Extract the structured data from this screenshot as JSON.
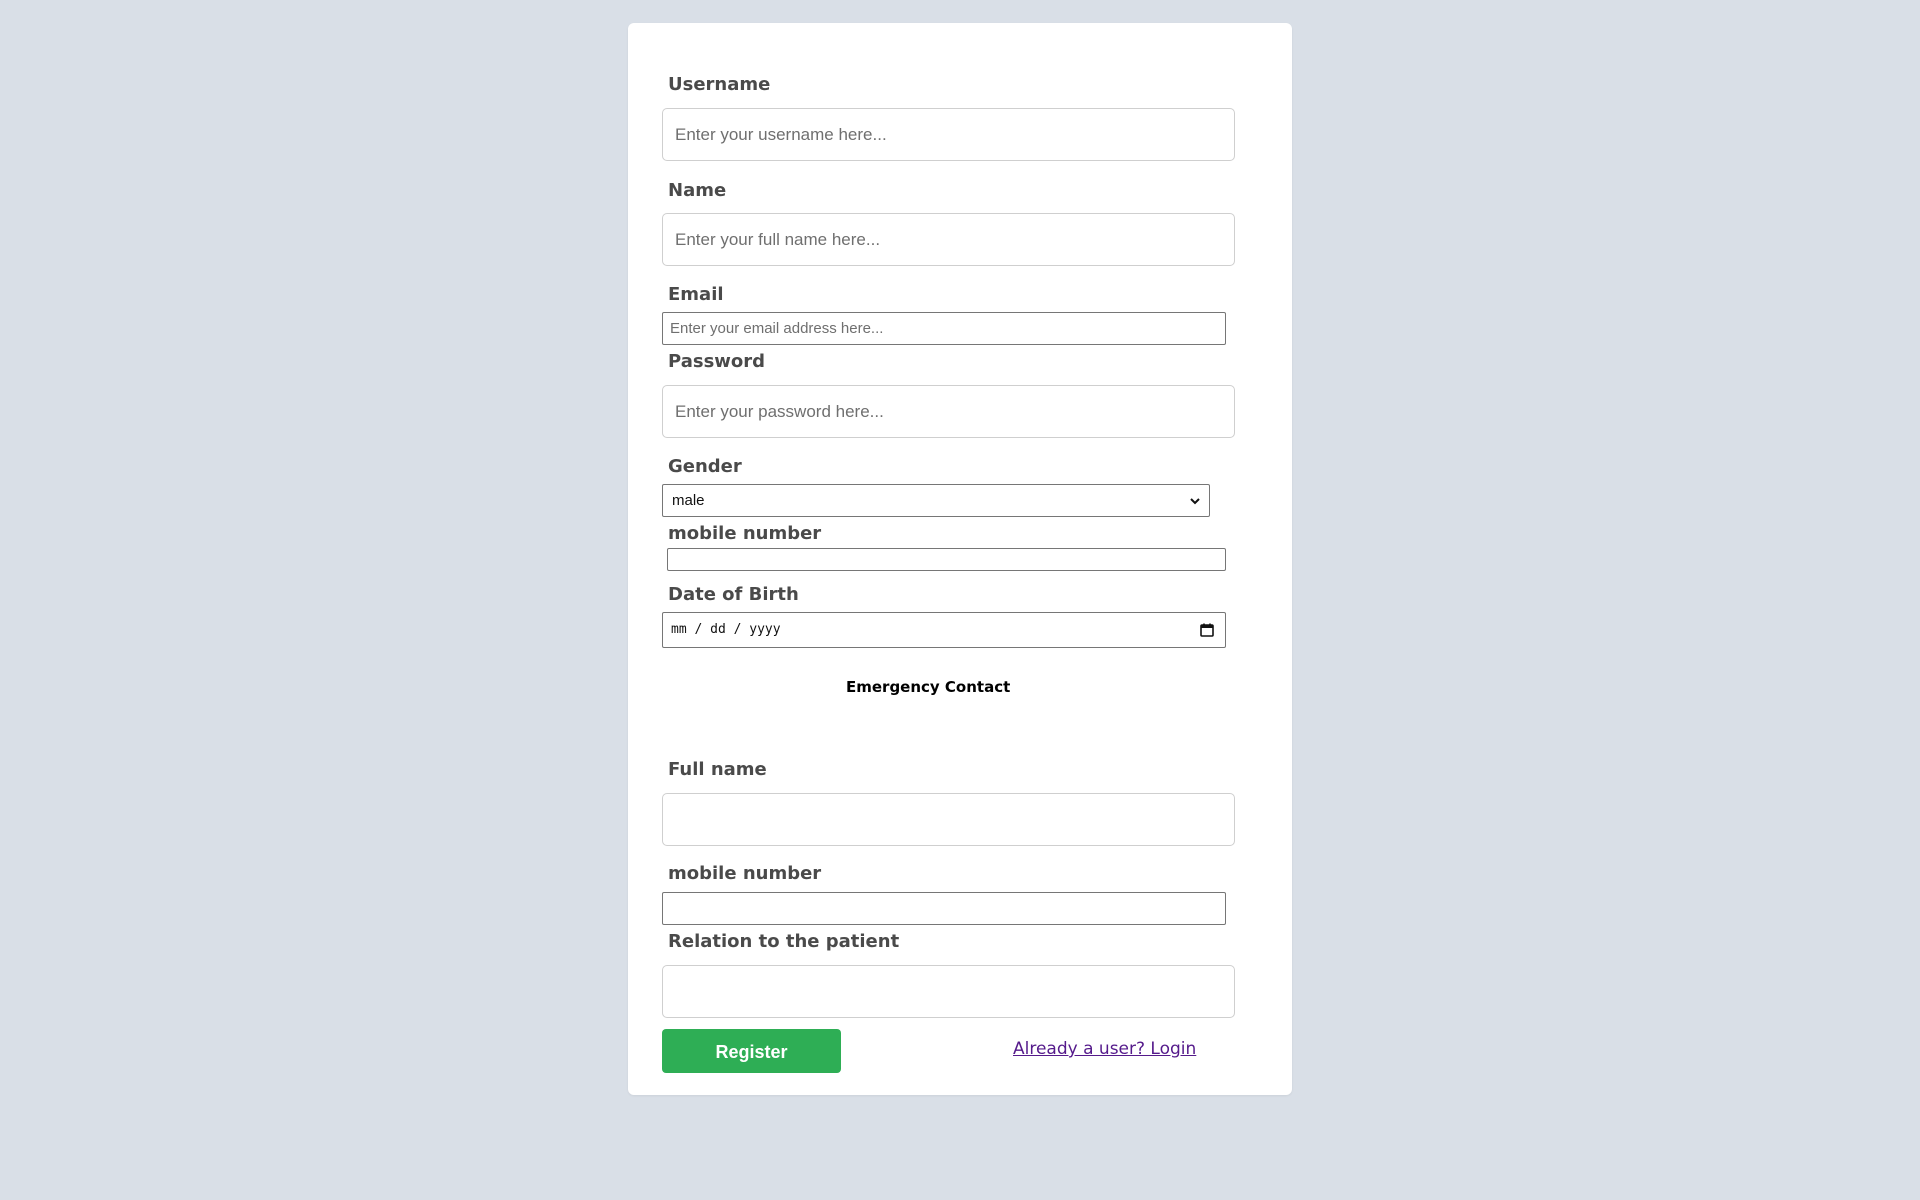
{
  "form": {
    "username": {
      "label": "Username",
      "placeholder": "Enter your username here...",
      "value": ""
    },
    "name": {
      "label": "Name",
      "placeholder": "Enter your full name here...",
      "value": ""
    },
    "email": {
      "label": "Email",
      "placeholder": "Enter your email address here...",
      "value": ""
    },
    "password": {
      "label": "Password",
      "placeholder": "Enter your password here...",
      "value": ""
    },
    "gender": {
      "label": "Gender",
      "selected": "male"
    },
    "mobile": {
      "label": "mobile number",
      "value": ""
    },
    "dob": {
      "label": "Date of Birth",
      "placeholder": "mm / dd / yyyy"
    }
  },
  "emergency": {
    "title": "Emergency Contact",
    "full_name": {
      "label": "Full name",
      "value": ""
    },
    "mobile": {
      "label": "mobile number",
      "value": ""
    },
    "relation": {
      "label": "Relation to the patient",
      "value": ""
    }
  },
  "actions": {
    "register_label": "Register",
    "login_link": "Already a user? Login"
  },
  "icons": {
    "select": "chevron-down-icon",
    "date": "calendar-icon"
  },
  "colors": {
    "background": "#d9dfe7",
    "card": "#ffffff",
    "register_button": "#2eae55",
    "link": "#551a8b"
  }
}
